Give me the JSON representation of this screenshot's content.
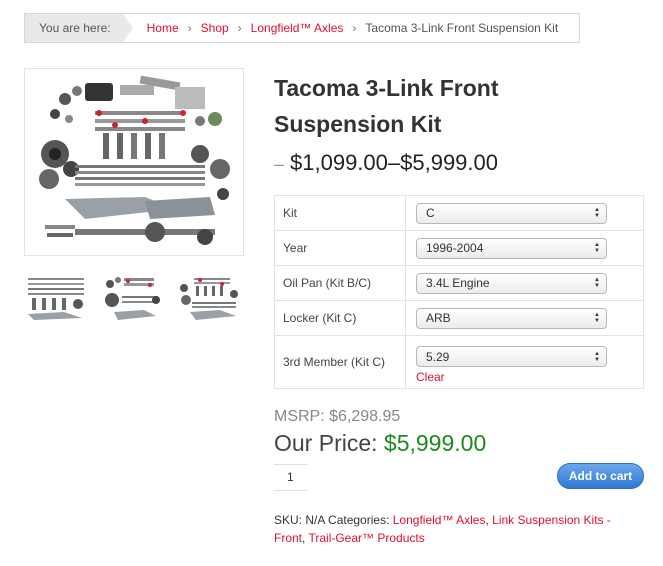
{
  "breadcrumb": {
    "here": "You are here:",
    "items": [
      "Home",
      "Shop",
      "Longfield™ Axles"
    ],
    "current": "Tacoma 3-Link Front Suspension Kit",
    "separator": "›"
  },
  "product": {
    "title": "Tacoma 3-Link Front Suspension Kit",
    "price_dash": "–",
    "price_range": "$1,099.00–$5,999.00"
  },
  "variations": [
    {
      "label": "Kit",
      "value": "C"
    },
    {
      "label": "Year",
      "value": "1996-2004"
    },
    {
      "label": "Oil Pan (Kit B/C)",
      "value": "3.4L Engine"
    },
    {
      "label": "Locker (Kit C)",
      "value": "ARB"
    },
    {
      "label": "3rd Member (Kit C)",
      "value": "5.29"
    }
  ],
  "clear_label": "Clear",
  "msrp": "MSRP: $6,298.95",
  "our_price": {
    "label": "Our Price:",
    "amount": "$5,999.00"
  },
  "quantity": "1",
  "add_to_cart": "Add to cart",
  "meta": {
    "sku": "SKU: N/A",
    "categories_label": "Categories:",
    "categories": [
      "Longfield™ Axles",
      "Link Suspension Kits - Front",
      "Trail-Gear™ Products"
    ]
  },
  "colors": {
    "link": "#e0102e",
    "price": "#1d8a1d",
    "button": "#2f78d1"
  }
}
